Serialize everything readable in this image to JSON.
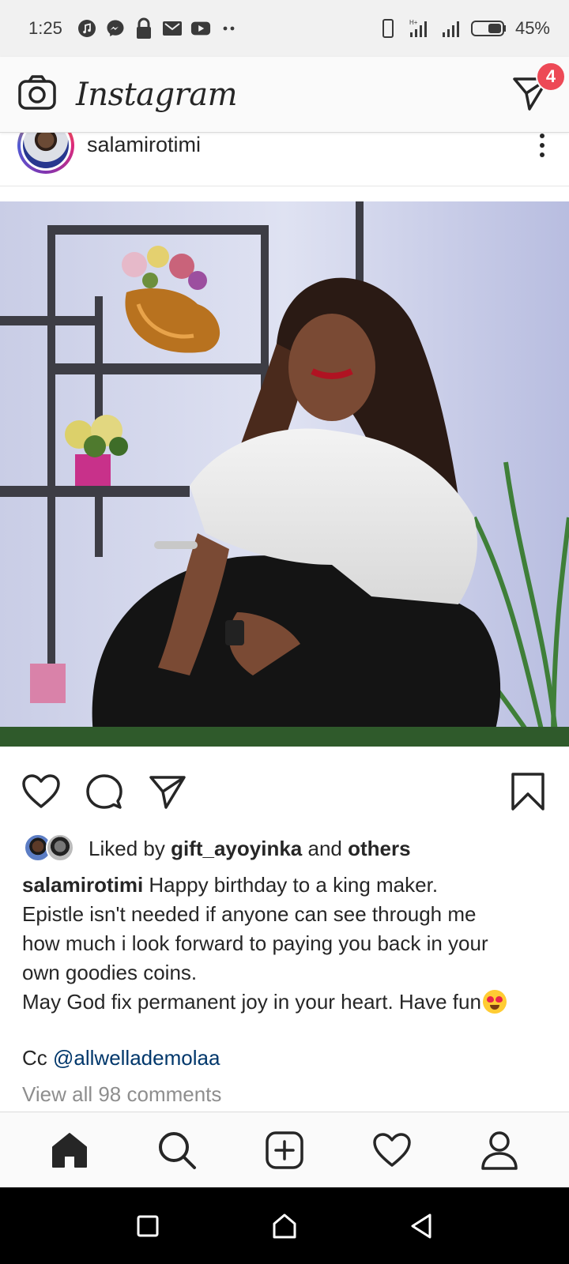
{
  "status_bar": {
    "time": "1:25",
    "battery": "45%",
    "network_label": "H+",
    "icons": [
      "music-icon",
      "messenger-icon",
      "lock-icon",
      "gmail-icon",
      "youtube-icon",
      "more-dots-icon",
      "phone-icon",
      "signal-icon",
      "signal-icon",
      "battery-icon"
    ]
  },
  "header": {
    "brand": "Instagram",
    "dm_badge": "4",
    "icons": [
      "camera-icon",
      "direct-message-icon"
    ]
  },
  "post": {
    "username": "salamirotimi",
    "image_alt": "",
    "likes": {
      "prefix": "Liked by",
      "user": "gift_ayoyinka",
      "middle": "and",
      "others": "others"
    },
    "caption": {
      "username": "salamirotimi",
      "line1": "Happy birthday to a king maker.",
      "line2": "Epistle isn't needed if anyone can see through me",
      "line3": "how much i look forward to paying you back in your",
      "line4": "own goodies coins.",
      "line5": "May God fix permanent joy in your heart. Have fun"
    },
    "cc_prefix": "Cc",
    "mention": "@allwellademolaa",
    "view_comments": "View all 98 comments"
  },
  "actions": {
    "icons": [
      "heart-icon",
      "comment-icon",
      "share-icon",
      "bookmark-icon"
    ]
  },
  "bottom_nav": {
    "icons": [
      "home-icon",
      "search-icon",
      "add-post-icon",
      "activity-heart-icon",
      "profile-icon"
    ]
  },
  "system_nav": {
    "icons": [
      "recents-square-icon",
      "home-circle-icon",
      "back-triangle-icon"
    ]
  },
  "colors": {
    "badge": "#ed4956",
    "mention": "#00376b",
    "muted": "#8e8e8e",
    "text": "#262626"
  }
}
